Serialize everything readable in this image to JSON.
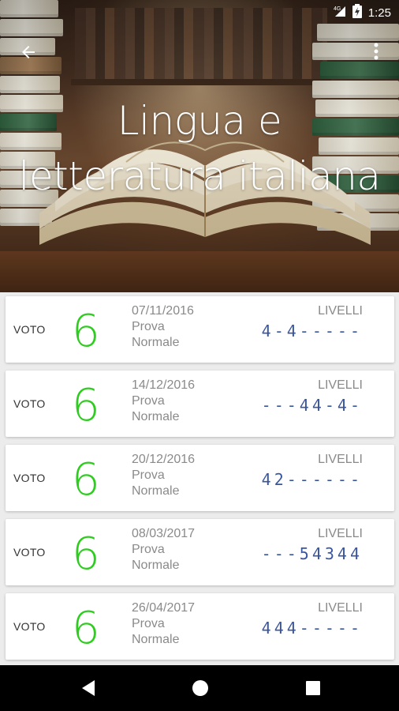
{
  "status": {
    "network": "4G",
    "time": "1:25"
  },
  "header": {
    "title_line1": "Lingua e",
    "title_line2": "letteratura italiana"
  },
  "icons": {
    "back": "arrow-back-icon",
    "menu": "more-vert-icon"
  },
  "colors": {
    "grade": "#2ecc1f",
    "levels": "#3a56a0",
    "label": "#8a8a8a"
  },
  "grades": [
    {
      "label": "VOTO",
      "value": "6",
      "date": "07/11/2016",
      "type_line1": "Prova",
      "type_line2": "Normale",
      "levels_label": "LIVELLI",
      "levels": "4-4-----"
    },
    {
      "label": "VOTO",
      "value": "6",
      "date": "14/12/2016",
      "type_line1": "Prova",
      "type_line2": "Normale",
      "levels_label": "LIVELLI",
      "levels": "---44-4-"
    },
    {
      "label": "VOTO",
      "value": "6",
      "date": "20/12/2016",
      "type_line1": "Prova",
      "type_line2": "Normale",
      "levels_label": "LIVELLI",
      "levels": "42------"
    },
    {
      "label": "VOTO",
      "value": "6",
      "date": "08/03/2017",
      "type_line1": "Prova",
      "type_line2": "Normale",
      "levels_label": "LIVELLI",
      "levels": "---54344"
    },
    {
      "label": "VOTO",
      "value": "6",
      "date": "26/04/2017",
      "type_line1": "Prova",
      "type_line2": "Normale",
      "levels_label": "LIVELLI",
      "levels": "444-----"
    }
  ],
  "navigation": {
    "back": "nav-back-icon",
    "home": "nav-home-icon",
    "recents": "nav-recents-icon"
  }
}
